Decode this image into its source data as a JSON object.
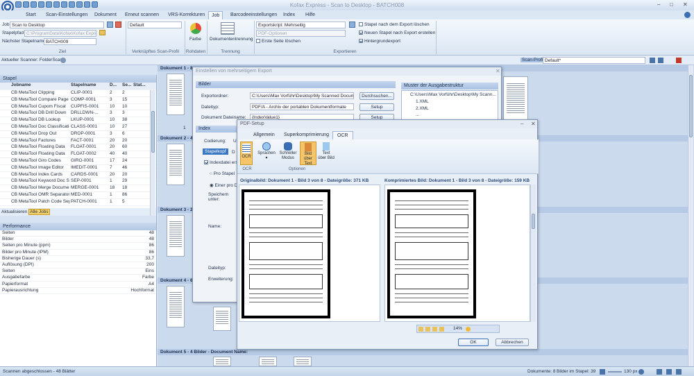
{
  "app": {
    "title": "Kofax Express - Scan to Desktop - BATCH008"
  },
  "tabs": [
    "Start",
    "Scan-Einstellungen",
    "Dokument",
    "Erneut scannen",
    "VRS-Korrekturen",
    "Job",
    "Barcodeeinstellungen",
    "Index",
    "Hilfe"
  ],
  "ribbon": {
    "job_label": "Job",
    "job_value": "Scan to Desktop",
    "stapelpfad_label": "Stapelpfad",
    "stapelpfad_value": "C:\\ProgramData\\Kofax\\Kofax Expre",
    "next_batch_label": "Nächster Stapelname",
    "next_batch_value": "BATCH009",
    "group_ziel": "Ziel",
    "profile_value": "Default",
    "group_profile": "Verknüpftes Scan-Profil",
    "farbe_label": "Farbe",
    "group_rohdaten": "Rohdaten",
    "doc_separation_label": "Dokumententrennung",
    "group_trennung": "Trennung",
    "exportskript_label": "Exportskript: Mehrseitig",
    "pdf_options_label": "PDF-Optionen",
    "first_page_delete": "Erste Seite löschen",
    "delete_after_export": "Stapel nach dem Export löschen",
    "new_batch_after_export": "Neuen Stapel nach Export erstellen",
    "background_export": "Hintergrundexport",
    "group_exportieren": "Exportieren"
  },
  "scanbar": {
    "scanner": "Aktueller Scanner: FolderScan",
    "profile_label": "Scan-Profil",
    "profile_value": "Default*"
  },
  "stapel": {
    "header": "Stapel",
    "columns": [
      "Jobname",
      "Stapelname",
      "D...",
      "Se...",
      "Stat..."
    ],
    "rows": [
      [
        "CB MetaTool Clipping",
        "CLIP-0001",
        "2",
        "2",
        ""
      ],
      [
        "CB MetaTool Compare Page Count",
        "COMP-0001",
        "3",
        "15",
        ""
      ],
      [
        "CB MetaTool Cupom Fiscal",
        "CUPFIS-0001",
        "10",
        "10",
        ""
      ],
      [
        "CB MetaTool DB Drill Down",
        "DRLLDWN-...",
        "3",
        "3",
        ""
      ],
      [
        "CB MetaTool DB Lookup",
        "LKUP-0001",
        "10",
        "38",
        ""
      ],
      [
        "CB MetaTool Doc Classification",
        "CLASS-0001",
        "10",
        "27",
        ""
      ],
      [
        "CB MetaTool Drop Out",
        "DROP-0001",
        "3",
        "6",
        ""
      ],
      [
        "CB MetaTool Factures",
        "FACT-0001",
        "20",
        "20",
        ""
      ],
      [
        "CB MetaTool Floating Data",
        "FLOAT-0001",
        "20",
        "60",
        ""
      ],
      [
        "CB MetaTool Floating Data",
        "FLOAT-0002",
        "40",
        "40",
        ""
      ],
      [
        "CB MetaTool Giro Codes",
        "GIRO-0001",
        "17",
        "24",
        ""
      ],
      [
        "CB MetaTool Image Editor",
        "IMEDIT-0001",
        "7",
        "46",
        ""
      ],
      [
        "CB MetaTool Index Cards",
        "CARDS-0001",
        "20",
        "20",
        ""
      ],
      [
        "CB MetaTool Keyword Doc Sep",
        "SEP-0001",
        "1",
        "29",
        ""
      ],
      [
        "CB MetaTool Merge Documents",
        "MERGE-0001",
        "18",
        "18",
        ""
      ],
      [
        "CB MetaTool OMR Separators",
        "MED-0001",
        "1",
        "86",
        ""
      ],
      [
        "CB MetaTool Patch Code Separa...",
        "PATCH-0001",
        "1",
        "5",
        ""
      ]
    ],
    "refresh_btn": "Aktualisieren",
    "all_jobs_btn": "Alle Jobs"
  },
  "performance": {
    "header": "Performance",
    "rows": [
      [
        "Seiten",
        "48"
      ],
      [
        "Bilder",
        "48"
      ],
      [
        "Seiten pro Minute (ppm)",
        "86"
      ],
      [
        "Bilder pro Minute (IPM)",
        "86"
      ],
      [
        "Bisherige Dauer (s)",
        "33,7"
      ],
      [
        "Auflösung (DPI)",
        "200"
      ],
      [
        "Seiten",
        "Eins"
      ],
      [
        "Ausgabefarbe",
        "Farbe"
      ],
      [
        "Papierformat",
        "A4"
      ],
      [
        "Papierausrichtung",
        "Hochformat"
      ]
    ]
  },
  "docs": {
    "doc1": "Dokument 1 - 8",
    "doc2": "Dokument 2 - 4",
    "doc3": "Dokument 3 - 2",
    "doc4": "Dokument 4 - 6",
    "doc5": "Dokument 5 - 4 Bilder - Document Name:",
    "thumb_num": "1"
  },
  "export_dialog": {
    "title": "Einstellen von mehrseitigem Export",
    "bilder": "Bilder",
    "exportordner_label": "Exportordner:",
    "exportordner_value": "C:\\Users\\Max Vorführ\\Desktop\\My Scanned Documer",
    "dateityp_label": "Dateityp:",
    "dateityp_value": "PDF/A - Archiv der portablen Dokumentformate",
    "docname_label": "Dokument Dateiname:",
    "docname_value": "{IndexValue1}",
    "browse_btn": "Durchsuchen...",
    "setup_btn": "Setup",
    "setup_btn2": "Setup",
    "muster_header": "Muster der Ausgabestruktur",
    "muster_path": "C:\\Users\\Max Vorführ\\Desktop\\My Scann...",
    "muster_file1": "1.XML",
    "muster_file2": "2.XML",
    "muster_more": "...",
    "index_header": "Index",
    "codierung_label": "Codierung:",
    "codierung_value": "U",
    "stapelkopf_tab": "Stapelkopf",
    "stapelkopf_tab2": "D",
    "indexdatei_label": "Indexdatei erst",
    "pro_stapel": "Pro Stapel",
    "einer_pro": "Einer pro D",
    "speichern_label": "Speichern unter:",
    "name_label": "Name:",
    "dateityp2_label": "Dateityp:",
    "erweiterung_label": "Erweiterung:"
  },
  "pdf_dialog": {
    "title": "PDF-Setup",
    "tabs": [
      "Allgemein",
      "Superkomprimierung",
      "OCR"
    ],
    "ocr_btn": "OCR",
    "sprachen_btn": "Sprachen",
    "schneller_btn": "Schneller Modus",
    "bild_uber_text_btn": "Bild über Text",
    "text_uber_bild_btn": "Text über Bild",
    "group_ocr": "OCR",
    "group_optionen": "Optionen",
    "original_caption": "Originalbild: Dokument 1 - Bild 3 von 8 - Dateigröße: 371 KB",
    "compressed_caption": "Komprimiertes Bild: Dokument 1 - Bild 3 von 8 - Dateigröße: 159 KB",
    "zoom": "14%",
    "ok_btn": "OK",
    "cancel_btn": "Abbrechen"
  },
  "status": {
    "left": "Scannen abgeschlossen - 48 Blätter",
    "documents": "Dokumente: 8",
    "images": "Bilder im Stapel: 39",
    "zoom": "130 px"
  }
}
